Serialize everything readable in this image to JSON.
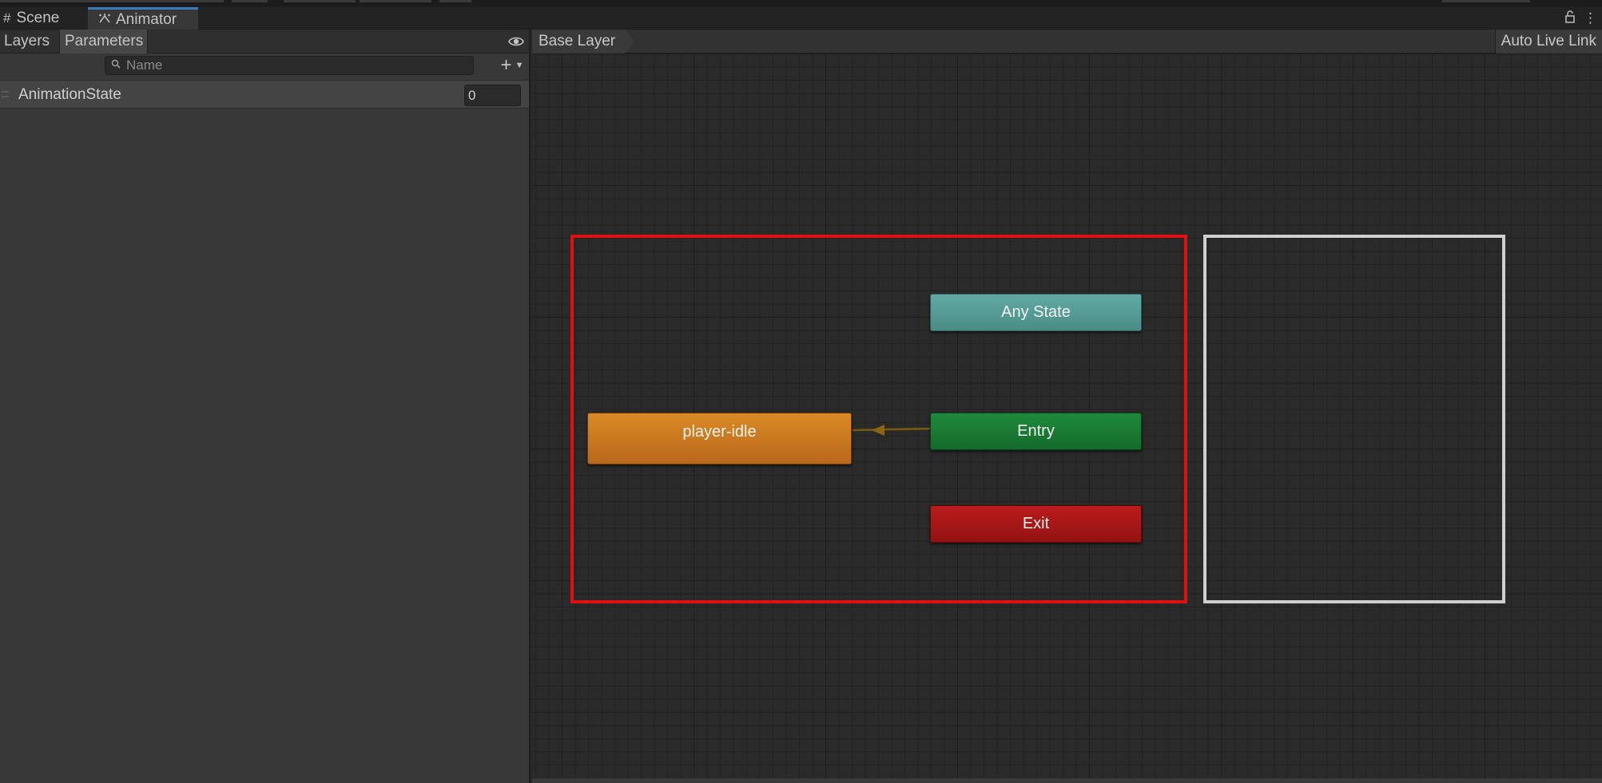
{
  "tabs": {
    "scene": {
      "label": "Scene",
      "icon": "grid-icon"
    },
    "animator": {
      "label": "Animator",
      "icon": "animator-icon"
    }
  },
  "left_panel": {
    "tabs": [
      "Layers",
      "Parameters"
    ],
    "search": {
      "placeholder": "Name",
      "value": ""
    },
    "parameters": [
      {
        "name": "AnimationState",
        "value": "0"
      }
    ]
  },
  "graph": {
    "breadcrumb": "Base Layer",
    "live_link": "Auto Live Link",
    "states": {
      "any_state": "Any State",
      "entry": "Entry",
      "exit": "Exit",
      "default": "player-idle"
    }
  },
  "colors": {
    "accent": "#3a79bb",
    "any_state": "#5aa09a",
    "entry": "#1a7a33",
    "exit": "#a81717",
    "default_state": "#c97620",
    "highlight_red": "#e01010",
    "highlight_white": "#cfcfcf"
  }
}
